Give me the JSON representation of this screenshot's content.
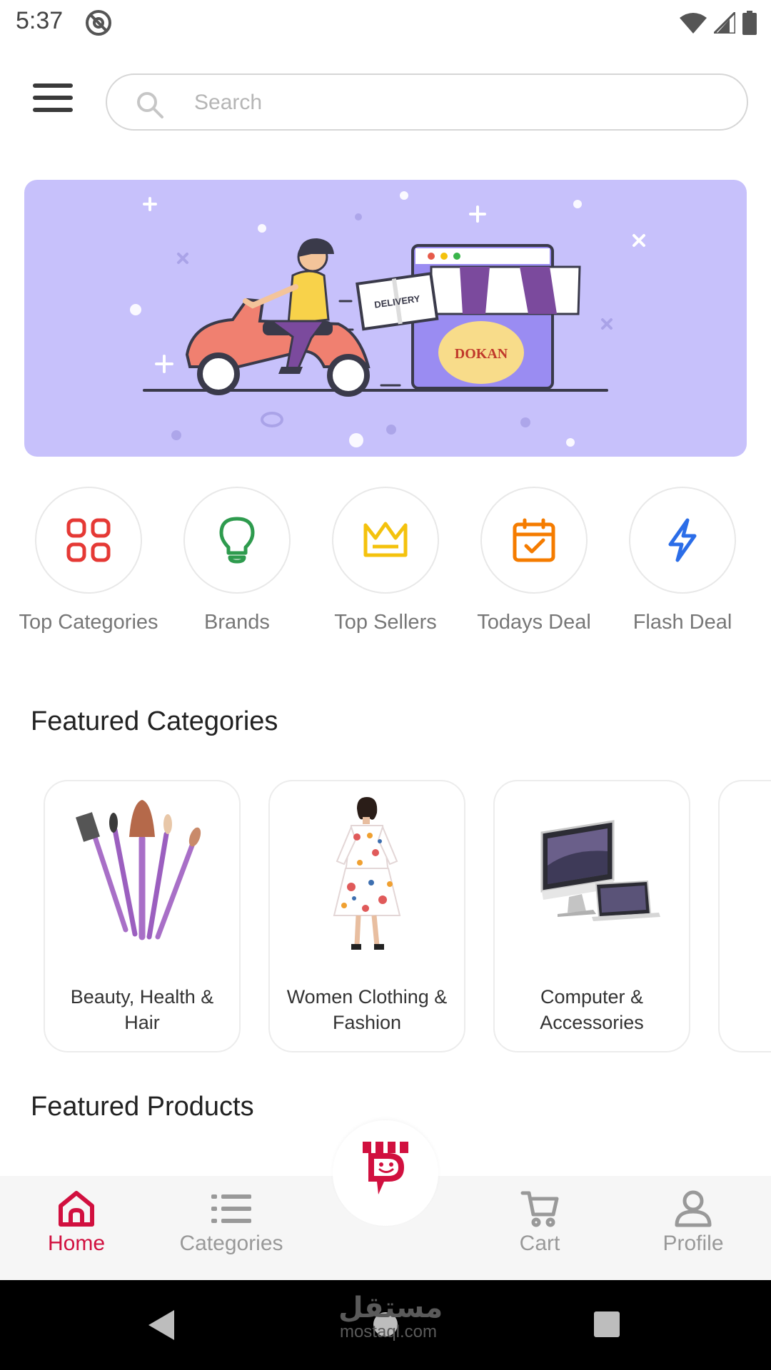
{
  "status_bar": {
    "time": "5:37"
  },
  "header": {
    "search_placeholder": "Search"
  },
  "banner": {
    "delivery_text": "DELIVERY",
    "store_name": "DOKAN"
  },
  "quick_actions": [
    {
      "label": "Top Categories",
      "icon": "grid-icon",
      "color": "#e53935"
    },
    {
      "label": "Brands",
      "icon": "lightbulb-icon",
      "color": "#2e9b4e"
    },
    {
      "label": "Top Sellers",
      "icon": "crown-icon",
      "color": "#f4c20d"
    },
    {
      "label": "Todays Deal",
      "icon": "calendar-check-icon",
      "color": "#f57c00"
    },
    {
      "label": "Flash Deal",
      "icon": "lightning-icon",
      "color": "#2b6de8"
    }
  ],
  "featured_categories": {
    "title": "Featured Categories",
    "items": [
      {
        "name": "Beauty, Health & Hair"
      },
      {
        "name": "Women Clothing & Fashion"
      },
      {
        "name": "Computer & Accessories"
      }
    ]
  },
  "featured_products": {
    "title": "Featured Products"
  },
  "bottom_nav": {
    "items": [
      {
        "label": "Home",
        "icon": "home-icon",
        "active": true
      },
      {
        "label": "Categories",
        "icon": "list-icon",
        "active": false
      },
      {
        "label": "Cart",
        "icon": "cart-icon",
        "active": false
      },
      {
        "label": "Profile",
        "icon": "profile-icon",
        "active": false
      }
    ]
  },
  "watermark": {
    "arabic": "مستقل",
    "latin": "mostaql.com"
  },
  "colors": {
    "accent": "#d1103f",
    "banner_bg": "#c7c1fb",
    "inactive": "#999999"
  }
}
